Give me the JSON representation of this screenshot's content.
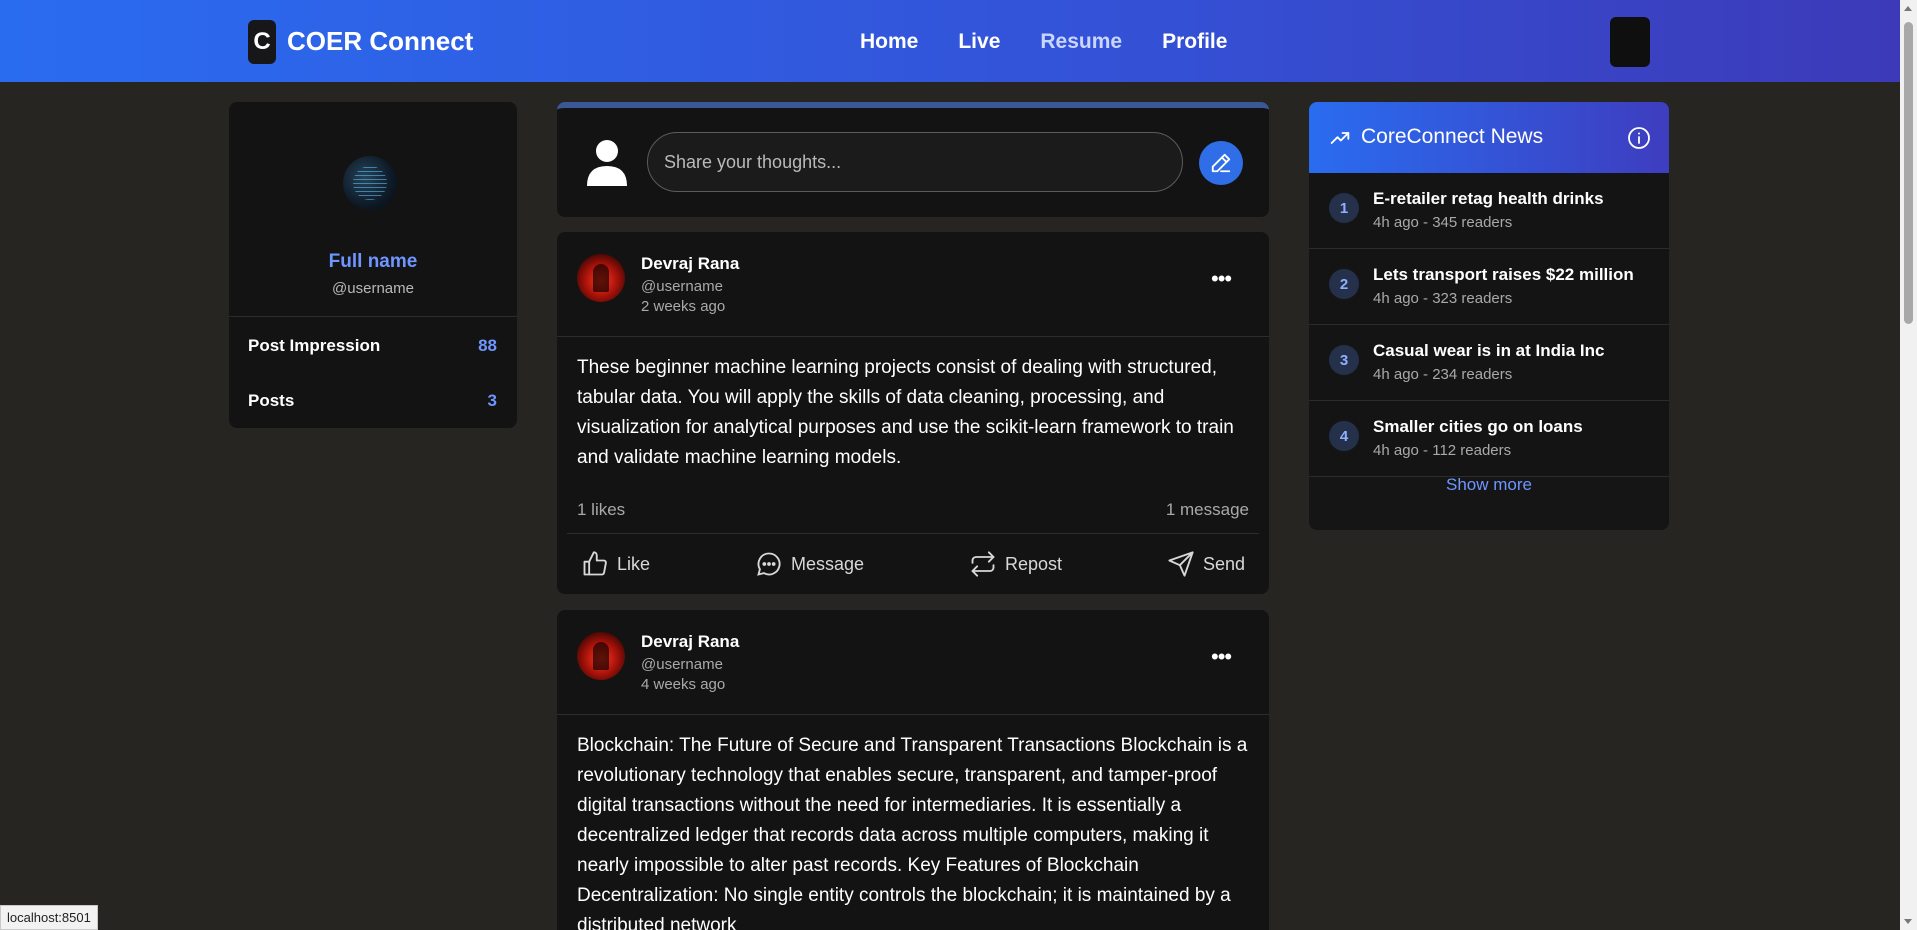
{
  "navbar": {
    "logo_letter": "C",
    "app_name": "COER Connect",
    "links": [
      "Home",
      "Live",
      "Resume",
      "Profile"
    ],
    "active_link": "Resume"
  },
  "profile": {
    "full_name": "Full name",
    "username": "@username",
    "stats": [
      {
        "label": "Post Impression",
        "value": "88"
      },
      {
        "label": "Posts",
        "value": "3"
      }
    ]
  },
  "composer": {
    "placeholder": "Share your thoughts..."
  },
  "posts": [
    {
      "author": "Devraj Rana",
      "handle": "@username",
      "time": "2 weeks ago",
      "body": "These beginner machine learning projects consist of dealing with structured, tabular data. You will apply the skills of data cleaning, processing, and visualization for analytical purposes and use the scikit-learn framework to train and validate machine learning models.",
      "likes": "1 likes",
      "messages": "1 message"
    },
    {
      "author": "Devraj Rana",
      "handle": "@username",
      "time": "4 weeks ago",
      "body": "Blockchain: The Future of Secure and Transparent Transactions Blockchain is a revolutionary technology that enables secure, transparent, and tamper-proof digital transactions without the need for intermediaries. It is essentially a decentralized ledger that records data across multiple computers, making it nearly impossible to alter past records. Key Features of Blockchain Decentralization: No single entity controls the blockchain; it is maintained by a distributed network"
    }
  ],
  "actions": {
    "like": "Like",
    "message": "Message",
    "repost": "Repost",
    "send": "Send"
  },
  "news": {
    "title": "CoreConnect News",
    "items": [
      {
        "num": "1",
        "headline": "E-retailer retag health drinks",
        "meta": "4h ago - 345 readers"
      },
      {
        "num": "2",
        "headline": "Lets transport raises $22 million",
        "meta": "4h ago - 323 readers"
      },
      {
        "num": "3",
        "headline": "Casual wear is in at India Inc",
        "meta": "4h ago - 234 readers"
      },
      {
        "num": "4",
        "headline": "Smaller cities go on loans",
        "meta": "4h ago - 112 readers"
      }
    ],
    "show_more": "Show more"
  },
  "status_bar": {
    "url": "localhost:8501"
  },
  "colors": {
    "accent": "#6f95ff",
    "nav_gradient_start": "#2a6cf0",
    "nav_gradient_end": "#3c3ab8",
    "background": "#262522",
    "card": "#131313"
  }
}
